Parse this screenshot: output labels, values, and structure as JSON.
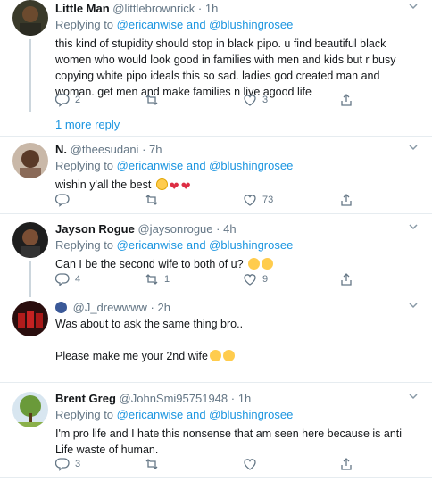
{
  "tweets": [
    {
      "name": "Little Man",
      "handle": "@littlebrownrick",
      "dot": "·",
      "time": "1h",
      "replying_prefix": "Replying to ",
      "replying_to": "@ericanwise and @blushingrosee",
      "text": "this kind of stupidity should stop in black pipo. u find beautiful black women who would look good in families with men and kids but r busy copying white pipo ideals this so sad. ladies god created man and woman. get men and make families n live agood life",
      "reply_count": "2",
      "retweet_count": "",
      "like_count": "3"
    },
    {
      "name": "N.",
      "handle": "@theesudani",
      "dot": "·",
      "time": "7h",
      "replying_prefix": "Replying to ",
      "replying_to": "@ericanwise and @blushingrosee",
      "text": "wishin y'all the best",
      "reply_count": "",
      "retweet_count": "",
      "like_count": "73"
    },
    {
      "name": "Jayson Rogue",
      "handle": "@jaysonrogue",
      "dot": "·",
      "time": "4h",
      "replying_prefix": "Replying to ",
      "replying_to": "@ericanwise and @blushingrosee",
      "text": "Can I be the second wife to both of u?",
      "reply_count": "4",
      "retweet_count": "1",
      "like_count": "9"
    },
    {
      "name": "",
      "handle": "@J_drewwww",
      "dot": "·",
      "time": "2h",
      "text": "Was about to ask the same thing bro..",
      "text2": "Please make me your 2nd wife"
    },
    {
      "name": "Brent Greg",
      "handle": "@JohnSmi95751948",
      "dot": "·",
      "time": "1h",
      "replying_prefix": "Replying to ",
      "replying_to": "@ericanwise and @blushingrosee",
      "text": "I'm pro life and I hate this nonsense that am seen here because is anti Life waste of human.",
      "reply_count": "3",
      "retweet_count": "",
      "like_count": ""
    }
  ],
  "more_replies": "1 more reply",
  "colors": {
    "link": "#1b95e0",
    "muted": "#657786",
    "divider": "#e6ecf0"
  }
}
